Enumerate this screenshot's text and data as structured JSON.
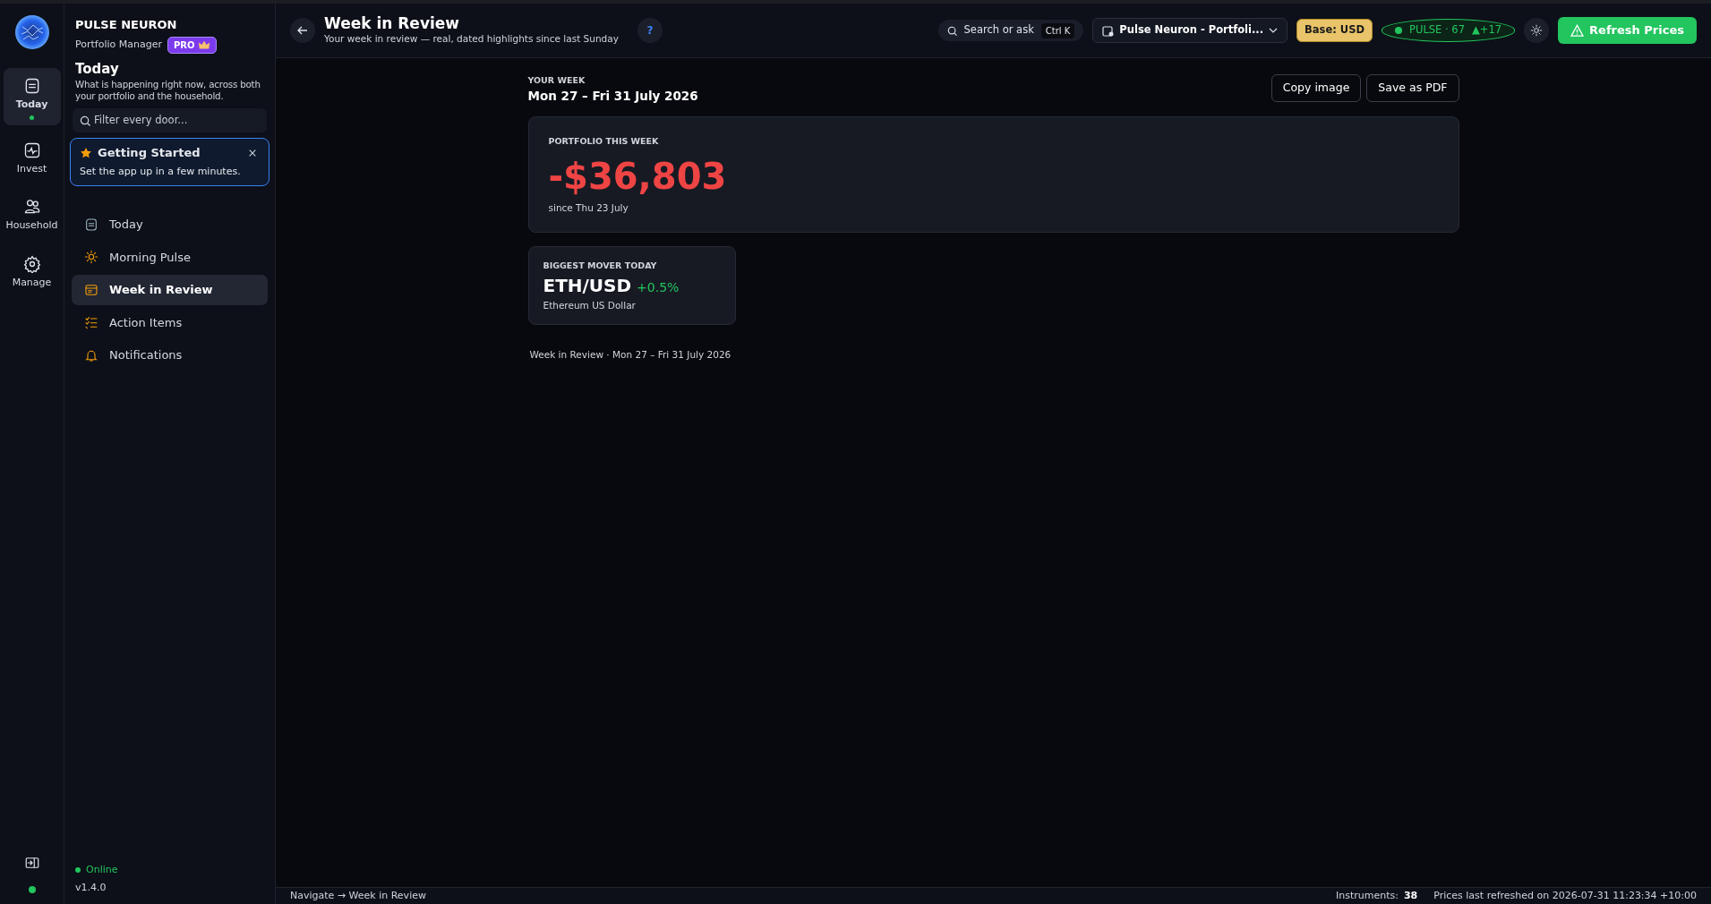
{
  "rail": {
    "items": [
      {
        "label": "Today",
        "kind": "today",
        "selected": true,
        "active_dot": true
      },
      {
        "label": "Invest",
        "kind": "invest",
        "selected": false,
        "active_dot": false
      },
      {
        "label": "Household",
        "kind": "household",
        "selected": false,
        "active_dot": false
      },
      {
        "label": "Manage",
        "kind": "manage",
        "selected": false,
        "active_dot": false
      }
    ],
    "online": true
  },
  "sidebar": {
    "brand": "PULSE NEURON",
    "subtitle": "Portfolio Manager",
    "plan_badge": "PRO",
    "section_title": "Today",
    "section_description": "What is happening right now, across both your portfolio and the household.",
    "filter": {
      "placeholder": "Filter every door..."
    },
    "getting_started": {
      "title": "Getting Started",
      "text": "Set the app up in a few minutes."
    },
    "items": [
      {
        "label": "Today",
        "kind": "today",
        "selected": false
      },
      {
        "label": "Morning Pulse",
        "kind": "sun",
        "selected": false
      },
      {
        "label": "Week in Review",
        "kind": "calendar",
        "selected": true
      },
      {
        "label": "Action Items",
        "kind": "checklist",
        "selected": false
      },
      {
        "label": "Notifications",
        "kind": "bell",
        "selected": false
      }
    ],
    "status": "Online",
    "online": true,
    "version": "v1.4.0"
  },
  "header": {
    "title": "Week in Review",
    "subtitle": "Your week in review — real, dated highlights since last Sunday",
    "help": "?",
    "search": {
      "placeholder": "Search or ask",
      "shortcut": "Ctrl K"
    },
    "portfolio": "Pulse Neuron - Portfoli...",
    "base": "Base: USD",
    "pulse": {
      "label": "PULSE · 67",
      "change": "▲+17"
    },
    "refresh": "Refresh Prices"
  },
  "week": {
    "eyebrow": "YOUR WEEK",
    "range": "Mon 27 – Fri 31 July 2026",
    "actions": [
      "Copy image",
      "Save as PDF"
    ],
    "portfolio": {
      "label": "PORTFOLIO THIS WEEK",
      "value": "-$36,803",
      "kind": "loss",
      "since": "since Thu 23 July"
    },
    "mover": {
      "label": "BIGGEST MOVER TODAY",
      "symbol": "ETH/USD",
      "change": "+0.5%",
      "kind": "gain",
      "name": "Ethereum US Dollar"
    },
    "footer": "Week in Review · Mon 27 – Fri 31 July 2026"
  },
  "status_bar": {
    "navigate": "Navigate → Week in Review",
    "instruments_label": "Instruments:",
    "instruments": "38",
    "refreshed": "Prices last refreshed on 2026-07-31 11:23:34 +10:00"
  }
}
